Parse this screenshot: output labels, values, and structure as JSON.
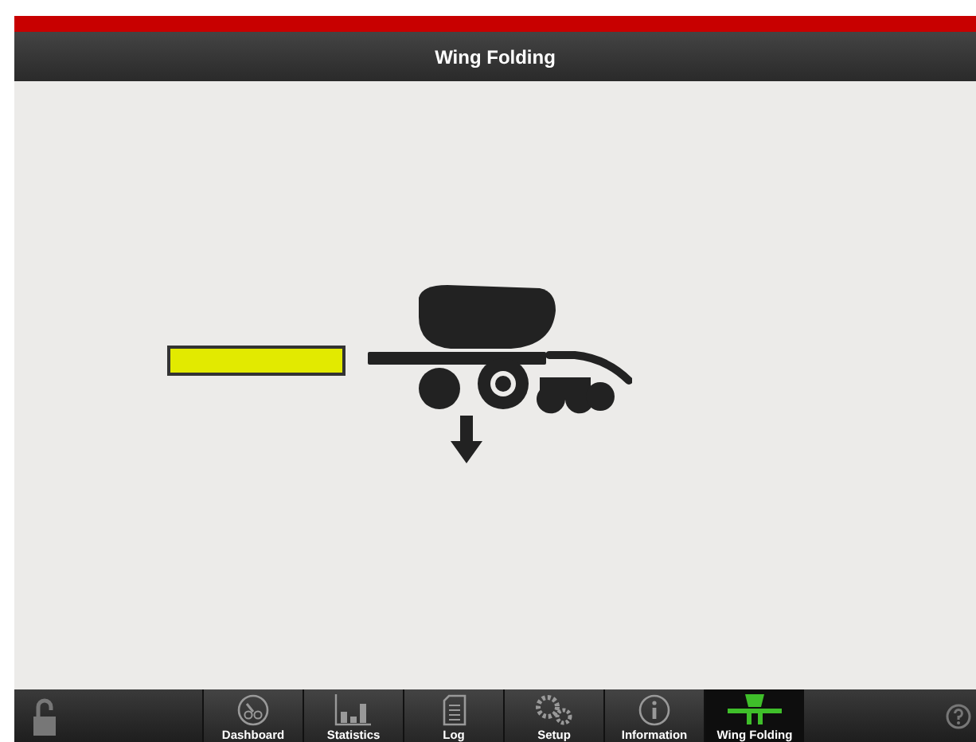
{
  "header": {
    "title": "Wing Folding"
  },
  "tabs": [
    {
      "label": "Dashboard",
      "kind": "gauge",
      "selected": false
    },
    {
      "label": "Statistics",
      "kind": "bars",
      "selected": false
    },
    {
      "label": "Log",
      "kind": "document",
      "selected": false
    },
    {
      "label": "Setup",
      "kind": "gears",
      "selected": false
    },
    {
      "label": "Information",
      "kind": "info",
      "selected": false
    },
    {
      "label": "Wing Folding",
      "kind": "wing",
      "selected": true
    }
  ]
}
